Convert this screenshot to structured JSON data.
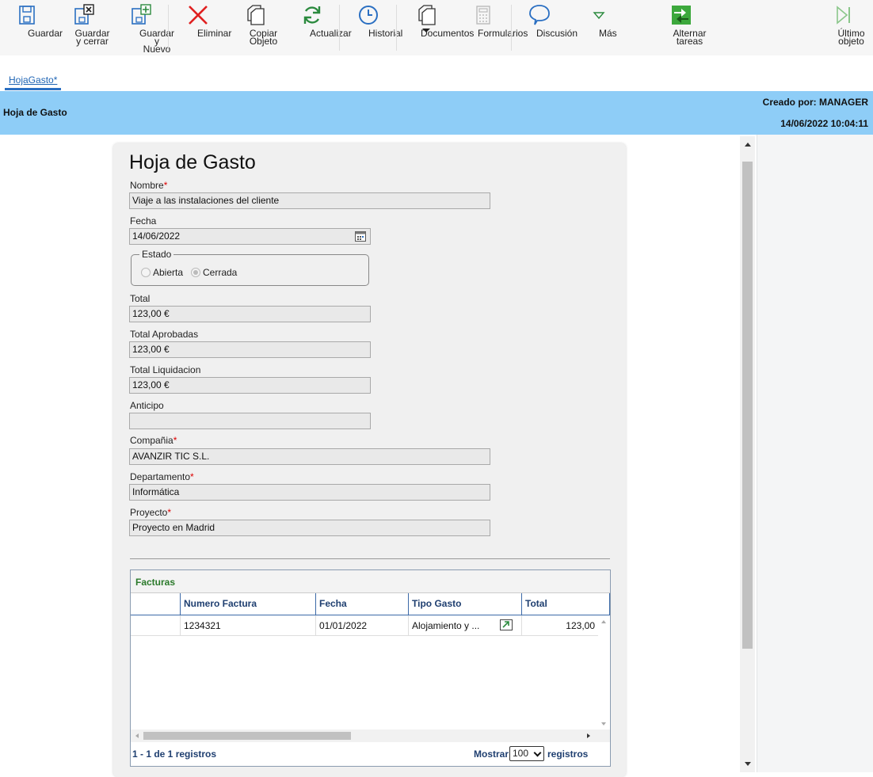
{
  "toolbar": {
    "save": "Guardar",
    "save_close": "Guardar y cerrar",
    "save_new": "Guardar y\nNuevo",
    "delete": "Eliminar",
    "copy": "Copiar Objeto",
    "refresh": "Actualizar",
    "history": "Historial",
    "documents": "Documentos",
    "forms": "Formularios",
    "discussion": "Discusión",
    "more": "Más",
    "toggle_tasks": "Alternar tareas",
    "last_object": "Último objeto"
  },
  "tab": {
    "label": "HojaGasto*"
  },
  "header": {
    "title": "Hoja de Gasto",
    "created_by": "Creado por: MANAGER",
    "created_at": "14/06/2022 10:04:11"
  },
  "form": {
    "title": "Hoja de Gasto",
    "nombre": {
      "label": "Nombre",
      "value": "Viaje a las instalaciones del cliente"
    },
    "fecha": {
      "label": "Fecha",
      "value": "14/06/2022"
    },
    "estado": {
      "legend": "Estado",
      "options": [
        "Abierta",
        "Cerrada"
      ],
      "selected": "Cerrada"
    },
    "total": {
      "label": "Total",
      "value": "123,00 €"
    },
    "total_aprobadas": {
      "label": "Total Aprobadas",
      "value": "123,00 €"
    },
    "total_liquidacion": {
      "label": "Total Liquidacion",
      "value": "123,00 €"
    },
    "anticipo": {
      "label": "Anticipo",
      "value": ""
    },
    "compania": {
      "label": "Compañia",
      "value": "AVANZIR TIC S.L."
    },
    "departamento": {
      "label": "Departamento",
      "value": "Informática"
    },
    "proyecto": {
      "label": "Proyecto",
      "value": "Proyecto en Madrid"
    }
  },
  "facturas": {
    "title": "Facturas",
    "columns": [
      "Numero Factura",
      "Fecha",
      "Tipo Gasto",
      "Total"
    ],
    "rows": [
      {
        "numero": "1234321",
        "fecha": "01/01/2022",
        "tipo": "Alojamiento y ...",
        "total": "123,00"
      }
    ],
    "footer": {
      "count": "1 - 1 de 1 registros",
      "show": "Mostrar",
      "page_size": "100",
      "registros": "registros"
    }
  },
  "colors": {
    "header_band": "#8ecdf7",
    "accent": "#2a6fc2",
    "grid_title": "#2b7a2b",
    "required": "#d00000"
  }
}
